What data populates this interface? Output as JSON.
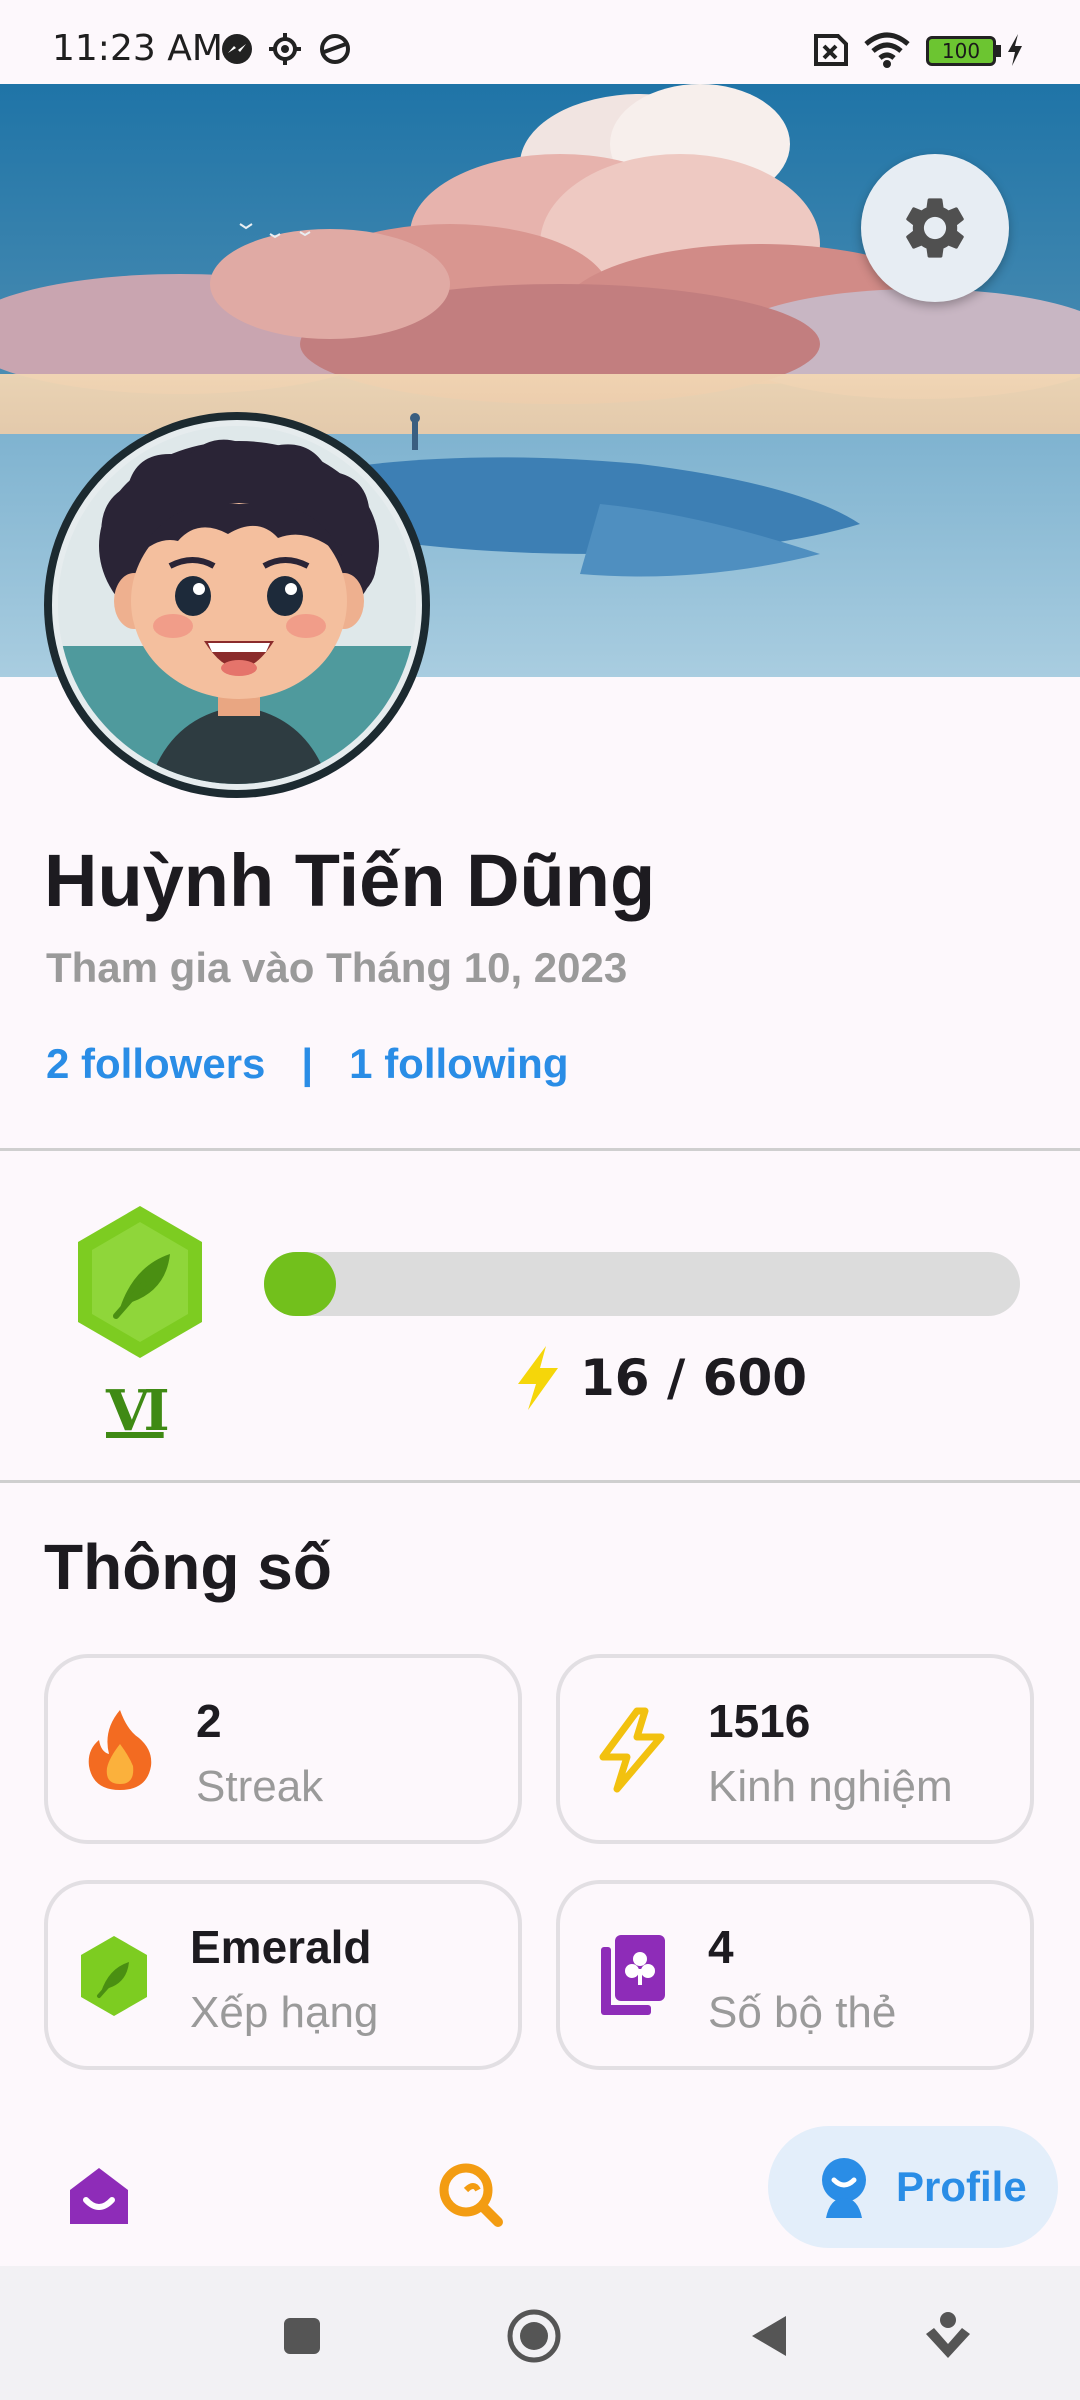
{
  "status_bar": {
    "time": "11:23 AM",
    "battery": "100"
  },
  "profile": {
    "name": "Huỳnh Tiến Dũng",
    "joined": "Tham gia vào Tháng 10, 2023",
    "followers": "2 followers",
    "separator": "|",
    "following": "1 following"
  },
  "level": {
    "roman": "VI",
    "xp_text": "16 / 600",
    "progress_fraction": 0.027
  },
  "stats": {
    "title": "Thông số",
    "cards": [
      {
        "value": "2",
        "label": "Streak",
        "icon": "fire-icon"
      },
      {
        "value": "1516",
        "label": "Kinh nghiệm",
        "icon": "lightning-icon"
      },
      {
        "value": "Emerald",
        "label": "Xếp hạng",
        "icon": "emerald-badge-icon"
      },
      {
        "value": "4",
        "label": "Số bộ thẻ",
        "icon": "card-deck-icon"
      }
    ]
  },
  "nav": {
    "profile_label": "Profile"
  },
  "colors": {
    "accent_blue": "#2a8de6",
    "green": "#72c01c",
    "purple": "#8e2cb8",
    "orange": "#f39c12"
  }
}
